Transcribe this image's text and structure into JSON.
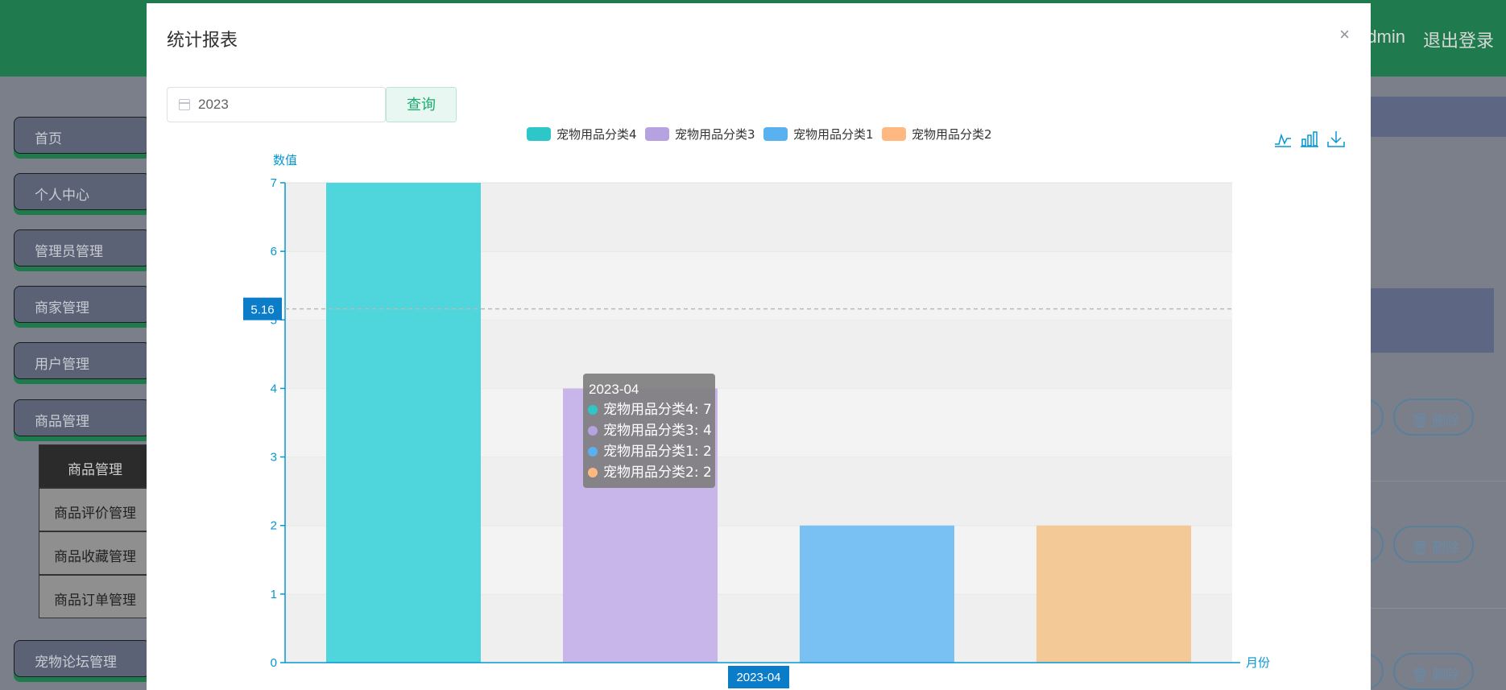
{
  "header": {
    "user": "admin",
    "logout": "退出登录"
  },
  "sidebar": {
    "items": [
      "首页",
      "个人中心",
      "管理员管理",
      "商家管理",
      "用户管理",
      "商品管理",
      "宠物论坛管理"
    ],
    "submenu": [
      "商品管理",
      "商品评价管理",
      "商品收藏管理",
      "商品订单管理"
    ]
  },
  "background_buttons": {
    "delete_label": "删除"
  },
  "modal": {
    "title": "统计报表",
    "year_value": "2023",
    "query_label": "查询",
    "close_icon": "×"
  },
  "colors": {
    "series": [
      "#4fd6dc",
      "#c8b6ea",
      "#78c1f2",
      "#f3ca97"
    ],
    "legend": [
      "#2ec7c9",
      "#b6a2de",
      "#5ab1ef",
      "#ffb980"
    ],
    "axis": "#0597d2",
    "tooltip_bg": "#7f7f7f"
  },
  "chart_data": {
    "type": "bar",
    "categories": [
      "2023-04"
    ],
    "series": [
      {
        "name": "宠物用品分类4",
        "values": [
          7
        ]
      },
      {
        "name": "宠物用品分类3",
        "values": [
          4
        ]
      },
      {
        "name": "宠物用品分类1",
        "values": [
          2
        ]
      },
      {
        "name": "宠物用品分类2",
        "values": [
          2
        ]
      }
    ],
    "xlabel": "月份",
    "ylabel": "数值",
    "ylim": [
      0,
      7
    ],
    "yticks": [
      0,
      1,
      2,
      3,
      4,
      5,
      6,
      7
    ],
    "grid": true,
    "legend_position": "top-center",
    "pointer_value": "5.16",
    "pointer_category": "2023-04",
    "tooltip": {
      "title": "2023-04",
      "lines": [
        "宠物用品分类4: 7",
        "宠物用品分类3: 4",
        "宠物用品分类1: 2",
        "宠物用品分类2: 2"
      ]
    }
  }
}
